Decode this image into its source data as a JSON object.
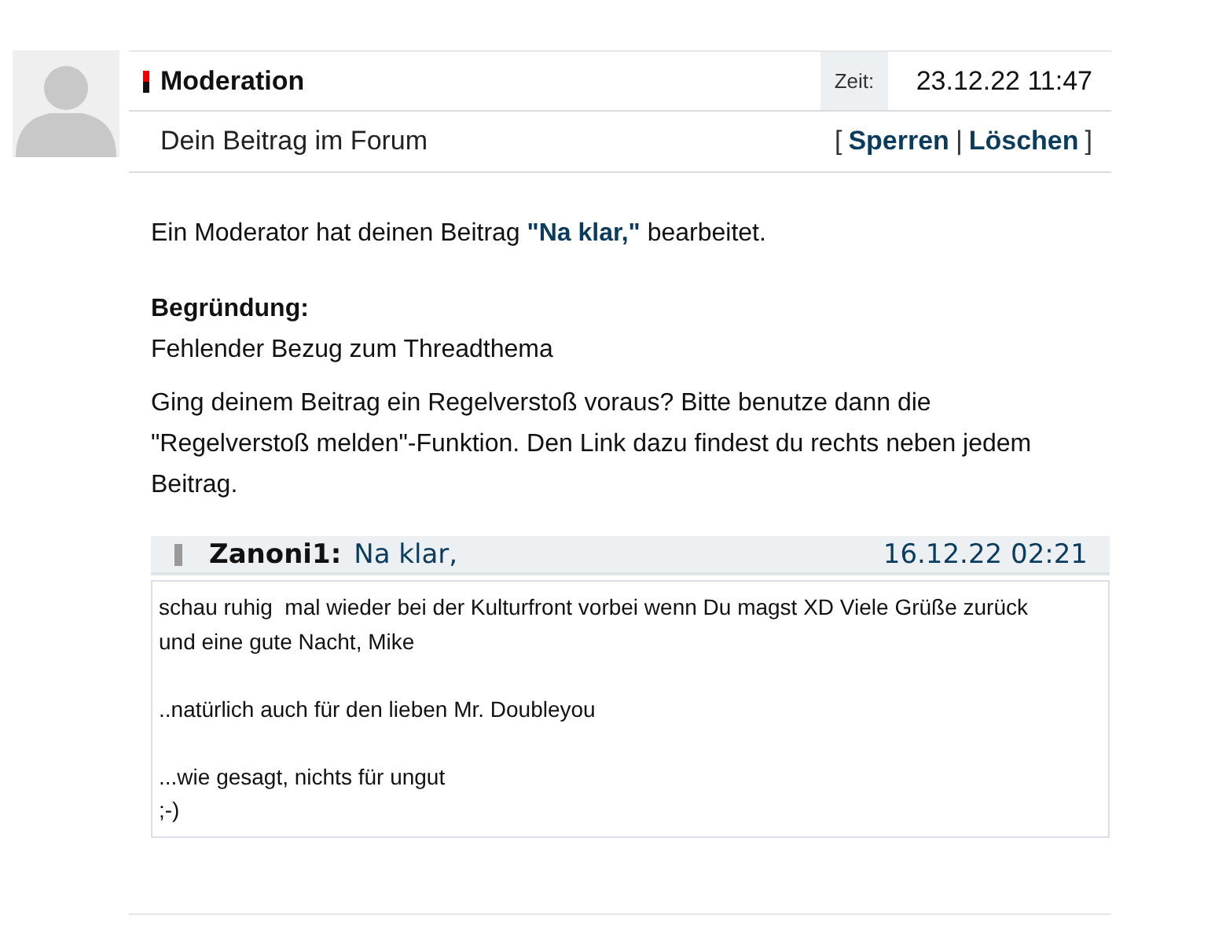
{
  "post": {
    "author": "Moderation",
    "time_label": "Zeit:",
    "time": "23.12.22 11:47",
    "subject": "Dein Beitrag im Forum",
    "actions": [
      {
        "label": "Sperren"
      },
      {
        "label": "Löschen"
      }
    ],
    "action_open": "[",
    "action_separator": "|",
    "action_close": "]"
  },
  "message": {
    "intro_before": "Ein Moderator hat deinen Beitrag ",
    "intro_link": "\"Na klar,\"",
    "intro_after": " bearbeitet.",
    "reason_label": "Begründung:",
    "reason": "Fehlender Bezug zum Threadthema",
    "hint": "Ging deinem Beitrag ein Regelverstoß voraus? Bitte benutze dann die \"Regelverstoß melden\"-Funktion. Den Link dazu findest du rechts neben jedem Beitrag."
  },
  "quote": {
    "author": "Zanoni1:",
    "title": "Na klar,",
    "time": "16.12.22 02:21",
    "paragraphs": [
      [
        "schau ruhig  mal wieder bei der Kulturfront vorbei wenn Du magst XD Viele Grüße zurück und eine gute Nacht, Mike"
      ],
      [
        "..natürlich auch für den lieben Mr. Doubleyou"
      ],
      [
        "...wie gesagt, nichts für ungut",
        ";-)"
      ]
    ]
  }
}
